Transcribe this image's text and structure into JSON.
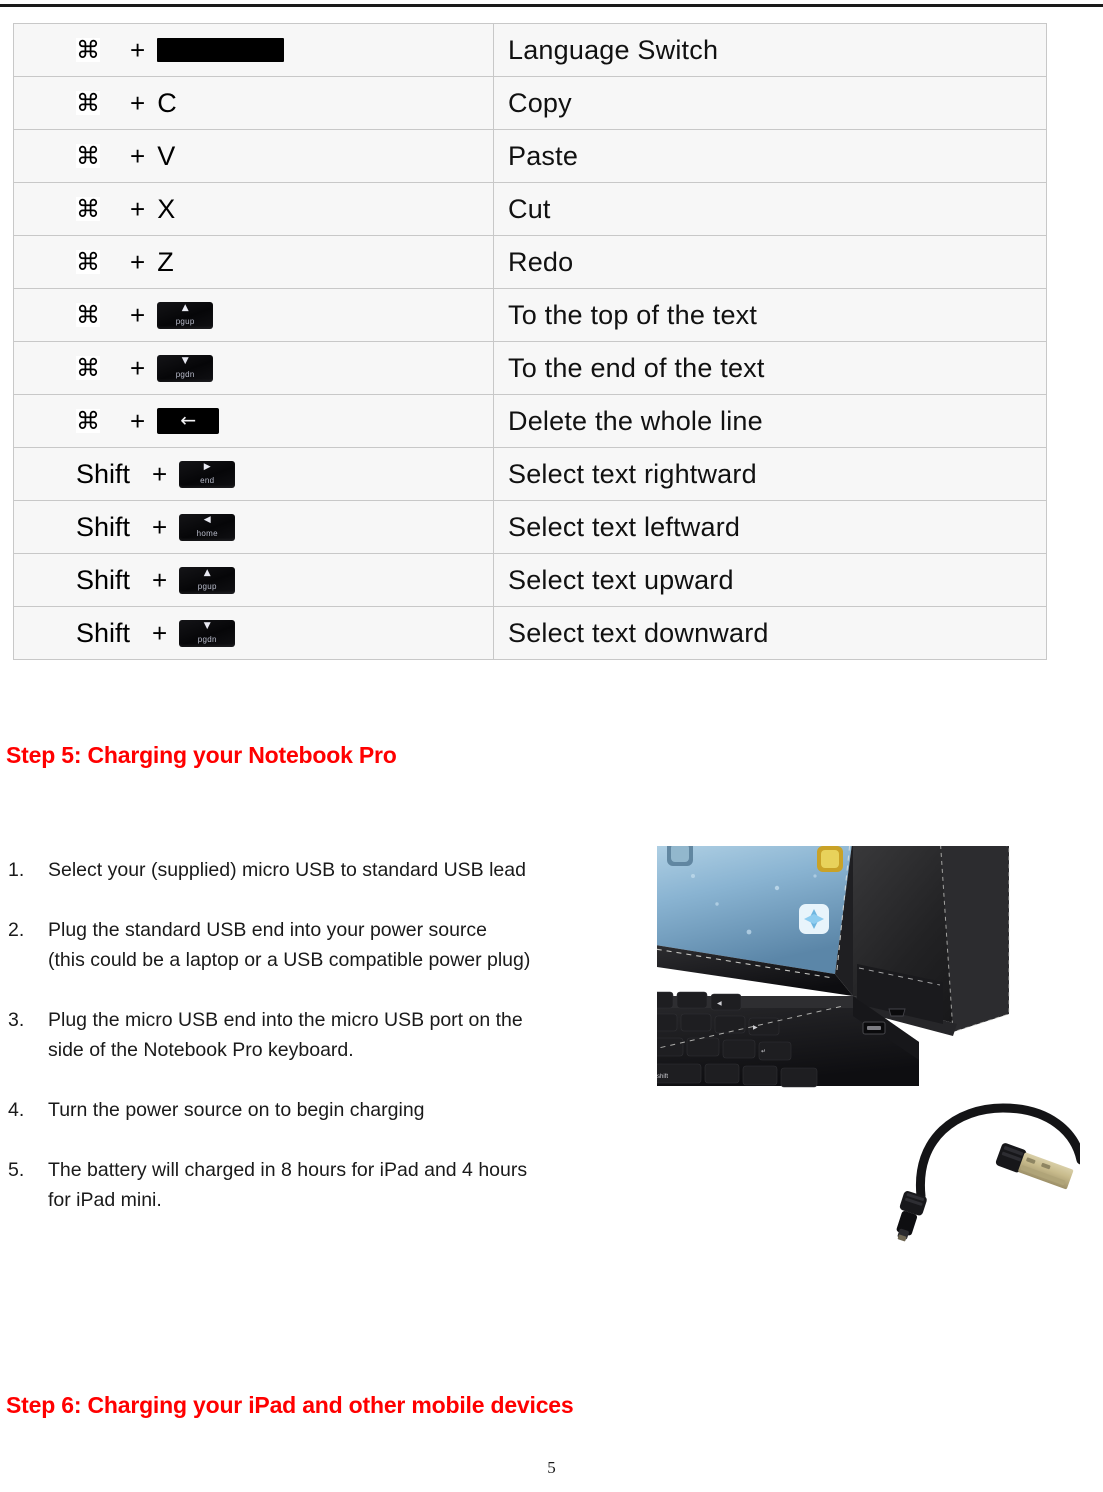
{
  "page": {
    "number": "5"
  },
  "shortcut_table": {
    "rows": [
      {
        "modifier": "⌘",
        "modifier_kind": "symbol",
        "key": {
          "type": "space-bar",
          "label": "",
          "arrow": ""
        },
        "description": "Language  Switch"
      },
      {
        "modifier": "⌘",
        "modifier_kind": "symbol",
        "key": {
          "type": "letter",
          "label": "C",
          "arrow": ""
        },
        "description": "Copy"
      },
      {
        "modifier": "⌘",
        "modifier_kind": "symbol",
        "key": {
          "type": "letter",
          "label": "V",
          "arrow": ""
        },
        "description": "Paste"
      },
      {
        "modifier": "⌘",
        "modifier_kind": "symbol",
        "key": {
          "type": "letter",
          "label": "X",
          "arrow": ""
        },
        "description": "Cut"
      },
      {
        "modifier": "⌘",
        "modifier_kind": "symbol",
        "key": {
          "type": "letter",
          "label": "Z",
          "arrow": ""
        },
        "description": "Redo"
      },
      {
        "modifier": "⌘",
        "modifier_kind": "symbol",
        "key": {
          "type": "keycap",
          "label": "pgup",
          "arrow": "▲"
        },
        "description": "To  the  top  of  the  text"
      },
      {
        "modifier": "⌘",
        "modifier_kind": "symbol",
        "key": {
          "type": "keycap",
          "label": "pgdn",
          "arrow": "▼"
        },
        "description": "To  the  end  of  the  text"
      },
      {
        "modifier": "⌘",
        "modifier_kind": "symbol",
        "key": {
          "type": "backspace",
          "label": "",
          "arrow": "←"
        },
        "description": "Delete  the  whole  line"
      },
      {
        "modifier": "Shift",
        "modifier_kind": "word",
        "key": {
          "type": "keycap",
          "label": "end",
          "arrow": "▶"
        },
        "description": "Select  text  rightward"
      },
      {
        "modifier": "Shift",
        "modifier_kind": "word",
        "key": {
          "type": "keycap",
          "label": "home",
          "arrow": "◀"
        },
        "description": "Select  text  leftward"
      },
      {
        "modifier": "Shift",
        "modifier_kind": "word",
        "key": {
          "type": "keycap",
          "label": "pgup",
          "arrow": "▲"
        },
        "description": "Select  text  upward"
      },
      {
        "modifier": "Shift",
        "modifier_kind": "word",
        "key": {
          "type": "keycap",
          "label": "pgdn",
          "arrow": "▼"
        },
        "description": "Select  text  downward"
      }
    ],
    "plus_sign": "+"
  },
  "step5": {
    "heading": "Step 5: Charging your Notebook Pro",
    "items": [
      {
        "marker": "1.",
        "lines": [
          "Select your (supplied) micro USB to standard USB lead"
        ]
      },
      {
        "marker": "2.",
        "lines": [
          "Plug the standard USB end into your power source",
          "(this could be a laptop or a USB compatible power plug)"
        ]
      },
      {
        "marker": "3.",
        "lines": [
          "Plug the micro USB end into the micro USB port on the",
          "side of the Notebook Pro keyboard."
        ]
      },
      {
        "marker": "4.",
        "lines": [
          "Turn the power source on to begin charging"
        ]
      },
      {
        "marker": "5.",
        "lines": [
          "The battery will charged in 8 hours for iPad and 4 hours",
          "for iPad mini."
        ]
      }
    ]
  },
  "step6": {
    "heading": "Step 6: Charging your iPad and other mobile devices"
  },
  "photo": {
    "alt": "iPad in black leather keyboard case with micro USB to USB cable"
  },
  "colors": {
    "heading_red": "#FF0000",
    "table_cell_bg": "#f7f7f7",
    "table_border": "#c8c8c8",
    "key_black": "#070708"
  }
}
